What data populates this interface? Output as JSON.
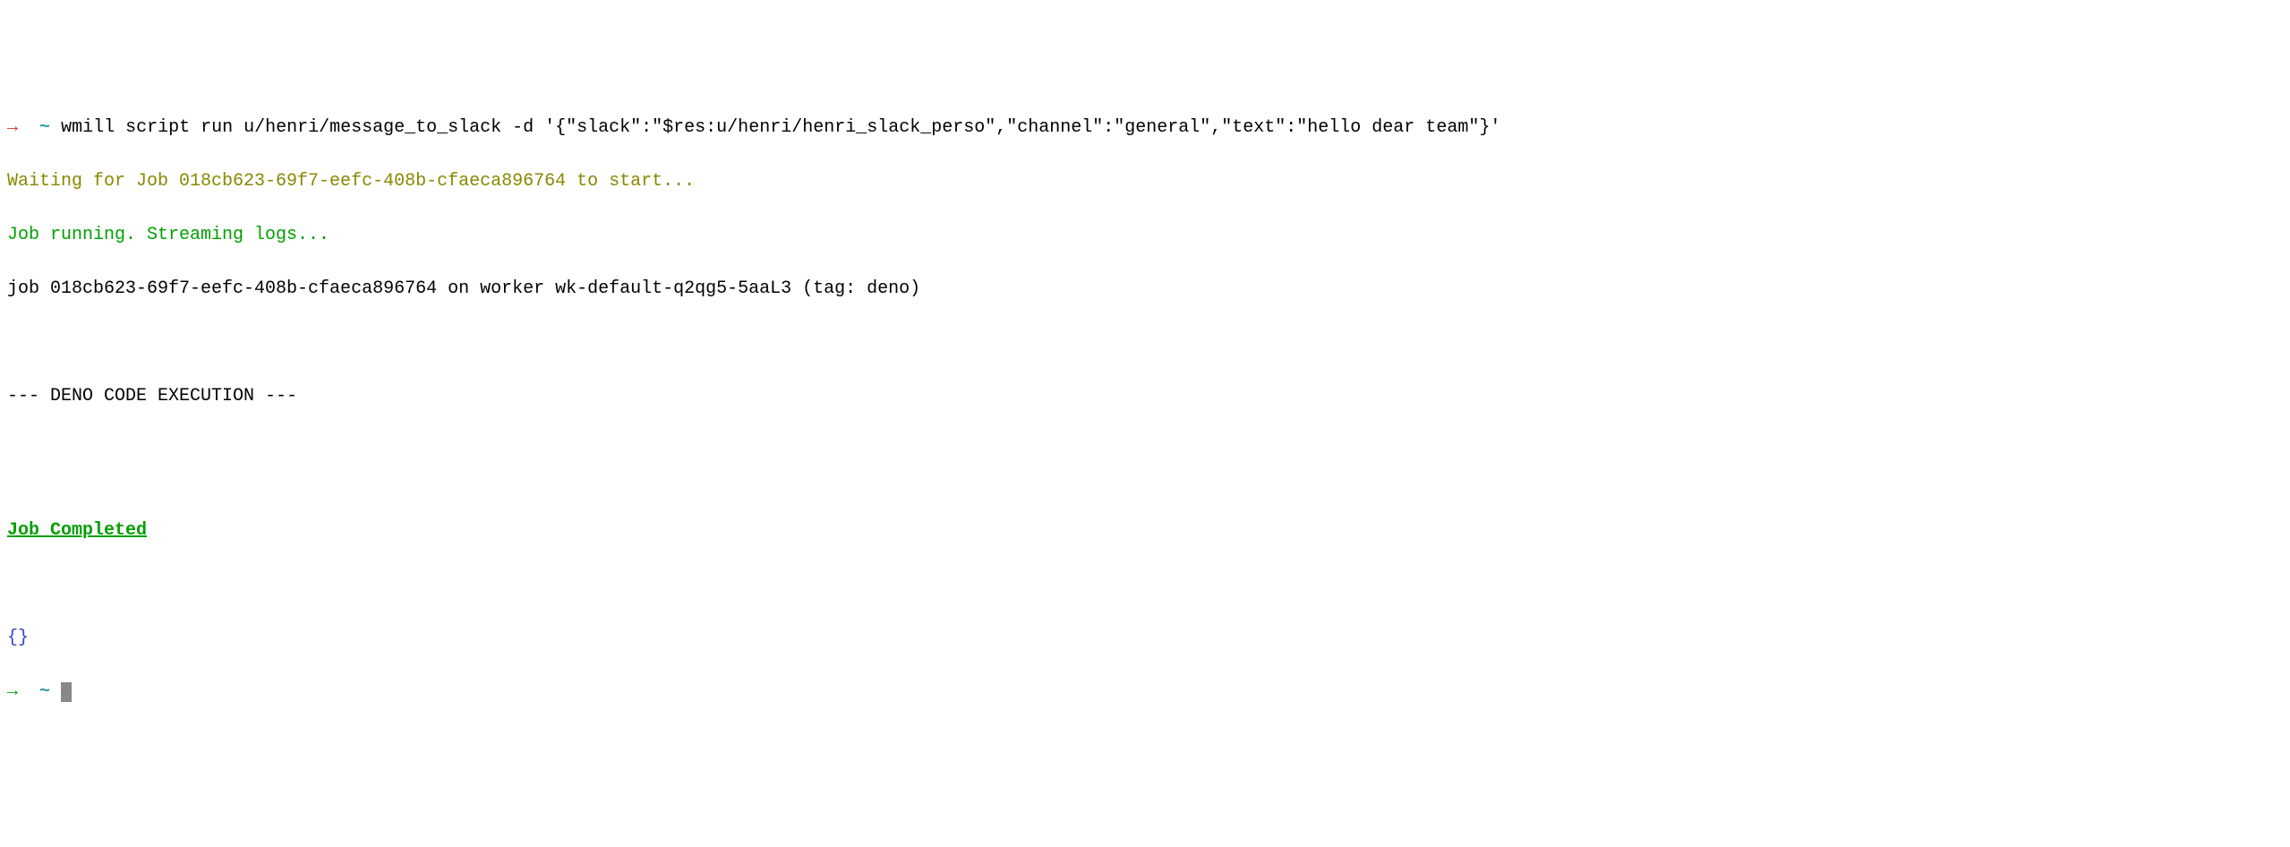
{
  "prompt": {
    "arrow": "→",
    "tilde": "~",
    "command": "wmill script run u/henri/message_to_slack -d '{\"slack\":\"$res:u/henri/henri_slack_perso\",\"channel\":\"general\",\"text\":\"hello dear team\"}'"
  },
  "output": {
    "waiting": "Waiting for Job 018cb623-69f7-eefc-408b-cfaeca896764 to start...",
    "running": "Job running. Streaming logs...",
    "job_info": "job 018cb623-69f7-eefc-408b-cfaeca896764 on worker wk-default-q2qg5-5aaL3 (tag: deno)",
    "blank1": "",
    "blank2": "",
    "deno_header": "--- DENO CODE EXECUTION ---",
    "blank3": "",
    "blank4": "",
    "blank5": "",
    "completed": "Job Completed",
    "blank6": "",
    "blank7": "",
    "result": "{}"
  },
  "prompt2": {
    "arrow": "→",
    "tilde": "~"
  }
}
